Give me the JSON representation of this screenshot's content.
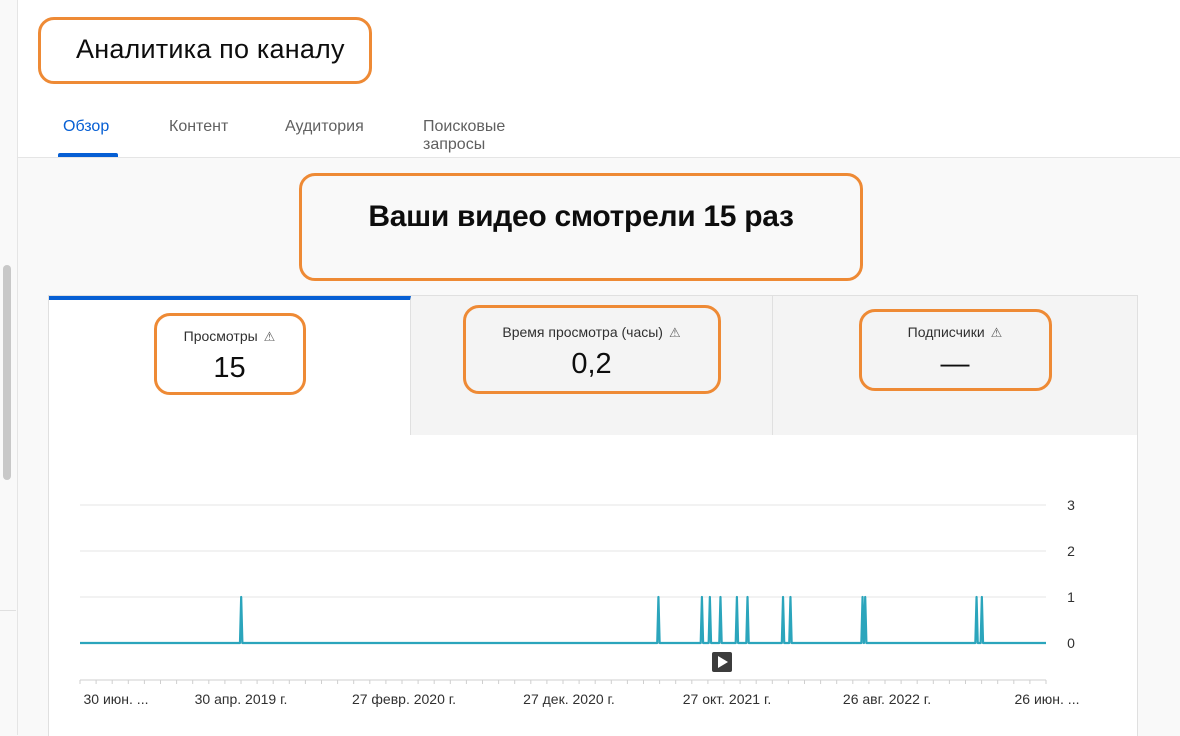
{
  "page": {
    "title": "Аналитика по каналу"
  },
  "tabs": [
    {
      "label": "Обзор",
      "active": true
    },
    {
      "label": "Контент",
      "active": false
    },
    {
      "label": "Аудитория",
      "active": false
    },
    {
      "label": "Поисковые запросы",
      "active": false
    }
  ],
  "headline": "Ваши видео смотрели 15 раз",
  "metrics": [
    {
      "label": "Просмотры",
      "value": "15",
      "icon": "warning-icon",
      "active": true
    },
    {
      "label": "Время просмотра (часы)",
      "value": "0,2",
      "icon": "warning-icon",
      "active": false
    },
    {
      "label": "Подписчики",
      "value": "—",
      "icon": "warning-icon",
      "active": false
    }
  ],
  "colors": {
    "accent": "#065fd4",
    "series": "#2ba5bc",
    "highlight": "#ee8a35"
  },
  "chart_data": {
    "type": "line",
    "y_ticks": [
      "3",
      "2",
      "1",
      "0"
    ],
    "ylim": [
      0,
      3
    ],
    "x_tick_labels": [
      "30 июн. ...",
      "30 апр. 2019 г.",
      "27 февр. 2020 г.",
      "27 дек. 2020 г.",
      "27 окт. 2021 г.",
      "26 авг. 2022 г.",
      "26 июн. ..."
    ],
    "x_start": "2018-06-30",
    "x_end": "2023-06-26",
    "series": [
      {
        "values_nonzero": [
          {
            "date": "2019-04-30",
            "value": 1
          },
          {
            "date": "2021-06-25",
            "value": 1
          },
          {
            "date": "2021-09-15",
            "value": 1
          },
          {
            "date": "2021-09-30",
            "value": 1
          },
          {
            "date": "2021-10-20",
            "value": 1
          },
          {
            "date": "2021-11-20",
            "value": 1
          },
          {
            "date": "2021-12-10",
            "value": 1
          },
          {
            "date": "2022-02-15",
            "value": 1
          },
          {
            "date": "2022-03-01",
            "value": 1
          },
          {
            "date": "2022-07-15",
            "value": 1
          },
          {
            "date": "2022-07-20",
            "value": 1
          },
          {
            "date": "2023-02-15",
            "value": 1
          },
          {
            "date": "2023-02-25",
            "value": 1
          }
        ]
      }
    ],
    "grid": true
  }
}
